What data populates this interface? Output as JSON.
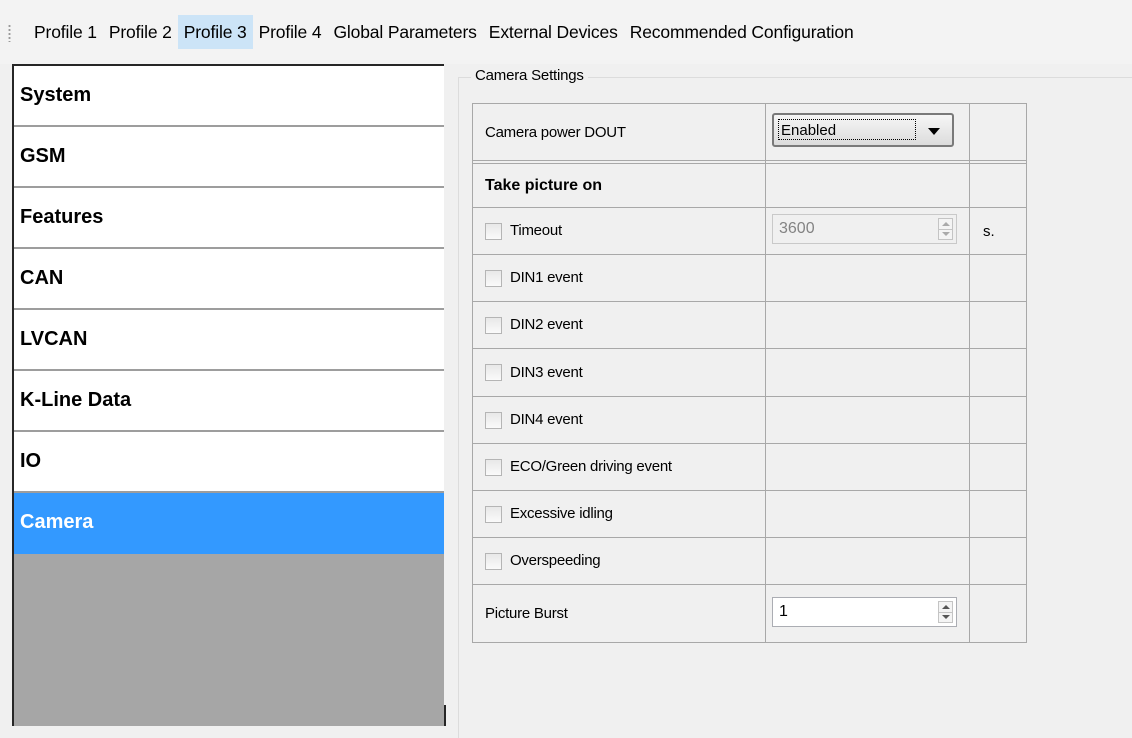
{
  "tabs": [
    {
      "label": "Profile 1",
      "active": false
    },
    {
      "label": "Profile 2",
      "active": false
    },
    {
      "label": "Profile 3",
      "active": true
    },
    {
      "label": "Profile 4",
      "active": false
    },
    {
      "label": "Global Parameters",
      "active": false
    },
    {
      "label": "External Devices",
      "active": false
    },
    {
      "label": "Recommended Configuration",
      "active": false
    }
  ],
  "nav": {
    "items": [
      {
        "label": "System"
      },
      {
        "label": "GSM"
      },
      {
        "label": "Features"
      },
      {
        "label": "CAN"
      },
      {
        "label": "LVCAN"
      },
      {
        "label": "K-Line Data"
      },
      {
        "label": "IO"
      },
      {
        "label": "Camera",
        "selected": true
      }
    ]
  },
  "camera": {
    "group_title": "Camera Settings",
    "power_dout": {
      "label": "Camera power DOUT",
      "value": "Enabled"
    },
    "take_picture_header": "Take picture on",
    "timeout": {
      "label": "Timeout",
      "value": "3600",
      "unit": "s.",
      "checked": false
    },
    "events": [
      {
        "label": "DIN1 event",
        "checked": false
      },
      {
        "label": "DIN2 event",
        "checked": false
      },
      {
        "label": "DIN3 event",
        "checked": false
      },
      {
        "label": "DIN4 event",
        "checked": false
      },
      {
        "label": "ECO/Green driving event",
        "checked": false
      },
      {
        "label": "Excessive idling",
        "checked": false
      },
      {
        "label": "Overspeeding",
        "checked": false
      }
    ],
    "picture_burst": {
      "label": "Picture Burst",
      "value": "1"
    }
  },
  "colors": {
    "selected_nav": "#3399ff",
    "active_tab": "#cce4f7",
    "nav_empty_area": "#a6a6a6"
  }
}
